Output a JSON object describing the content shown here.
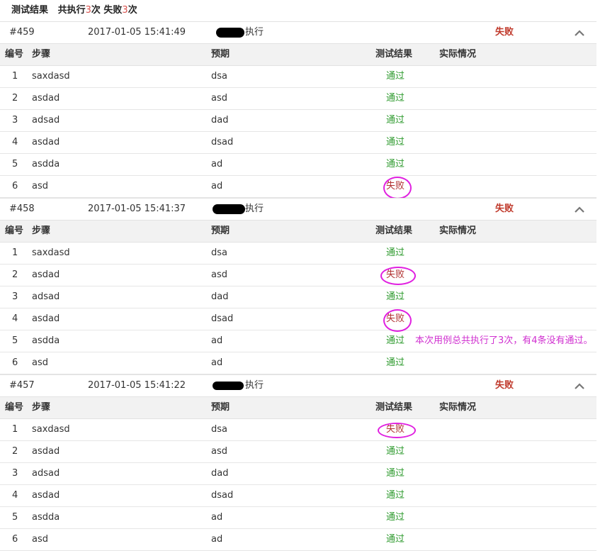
{
  "summary": {
    "label": "测试结果",
    "prefix": "共执行",
    "total": "3",
    "mid": "次 失败",
    "failed": "3",
    "suffix": "次"
  },
  "columns": {
    "no": "编号",
    "step": "步骤",
    "expected": "预期",
    "result": "测试结果",
    "actual": "实际情况"
  },
  "runs": [
    {
      "id": "#459",
      "time": "2017-01-05 15:41:49",
      "executor_label": "执行",
      "status": "失败",
      "rows": [
        {
          "no": "1",
          "step": "saxdasd",
          "expected": "dsa",
          "result": "通过"
        },
        {
          "no": "2",
          "step": "asdad",
          "expected": "asd",
          "result": "通过"
        },
        {
          "no": "3",
          "step": "adsad",
          "expected": "dad",
          "result": "通过"
        },
        {
          "no": "4",
          "step": "asdad",
          "expected": "dsad",
          "result": "通过"
        },
        {
          "no": "5",
          "step": "asdda",
          "expected": "ad",
          "result": "通过"
        },
        {
          "no": "6",
          "step": "asd",
          "expected": "ad",
          "result": "失败"
        }
      ]
    },
    {
      "id": "#458",
      "time": "2017-01-05 15:41:37",
      "executor_label": "执行",
      "status": "失败",
      "rows": [
        {
          "no": "1",
          "step": "saxdasd",
          "expected": "dsa",
          "result": "通过"
        },
        {
          "no": "2",
          "step": "asdad",
          "expected": "asd",
          "result": "失败"
        },
        {
          "no": "3",
          "step": "adsad",
          "expected": "dad",
          "result": "通过"
        },
        {
          "no": "4",
          "step": "asdad",
          "expected": "dsad",
          "result": "失败"
        },
        {
          "no": "5",
          "step": "asdda",
          "expected": "ad",
          "result": "通过"
        },
        {
          "no": "6",
          "step": "asd",
          "expected": "ad",
          "result": "通过"
        }
      ]
    },
    {
      "id": "#457",
      "time": "2017-01-05 15:41:22",
      "executor_label": "执行",
      "status": "失败",
      "rows": [
        {
          "no": "1",
          "step": "saxdasd",
          "expected": "dsa",
          "result": "失败"
        },
        {
          "no": "2",
          "step": "asdad",
          "expected": "asd",
          "result": "通过"
        },
        {
          "no": "3",
          "step": "adsad",
          "expected": "dad",
          "result": "通过"
        },
        {
          "no": "4",
          "step": "asdad",
          "expected": "dsad",
          "result": "通过"
        },
        {
          "no": "5",
          "step": "asdda",
          "expected": "ad",
          "result": "通过"
        },
        {
          "no": "6",
          "step": "asd",
          "expected": "ad",
          "result": "通过"
        }
      ]
    }
  ],
  "annotation": "本次用例总共执行了3次，有4条没有通过。",
  "colors": {
    "pass": "#2e9a2e",
    "fail": "#b03030",
    "annotation": "#e020e0"
  },
  "icons": {
    "collapse": "chevron-up-icon",
    "redaction": "redacted-name-mark"
  }
}
